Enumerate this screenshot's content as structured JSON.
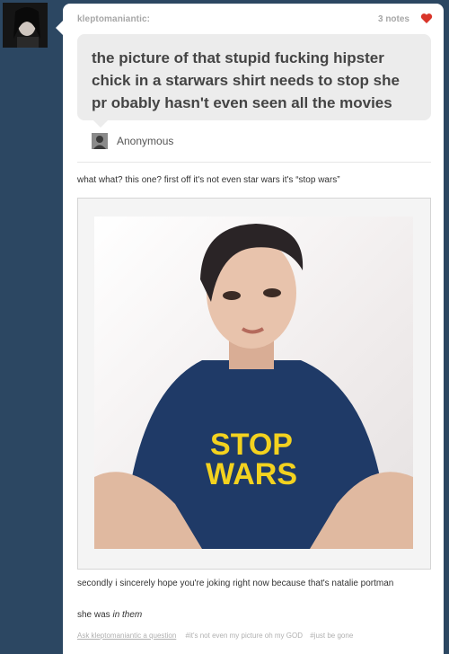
{
  "post": {
    "author": "kleptomaniantic:",
    "notes": "3 notes",
    "question": "the picture of that stupid fucking hipster chick in a starwars shirt needs to stop she pr obably hasn't even seen all the movies",
    "asker": "Anonymous",
    "answer_intro": "what what? this one? first off it's not even star wars it's “stop wars”",
    "photo": {
      "shirt_text_line1": "STOP",
      "shirt_text_line2": "WARS",
      "shirt_text_color": "#f3d21f",
      "shirt_color": "#1f3a67"
    },
    "answer_followup": "secondly i sincerely hope you're joking right now because that's natalie portman",
    "answer_final_prefix": "she was ",
    "answer_final_emph": "in them",
    "ask_link": "Ask kleptomaniantic a question",
    "tags": [
      "#it's not even my picture oh my GOD",
      "#just be gone"
    ]
  },
  "colors": {
    "background": "#2c4762",
    "heart": "#d9352a"
  }
}
